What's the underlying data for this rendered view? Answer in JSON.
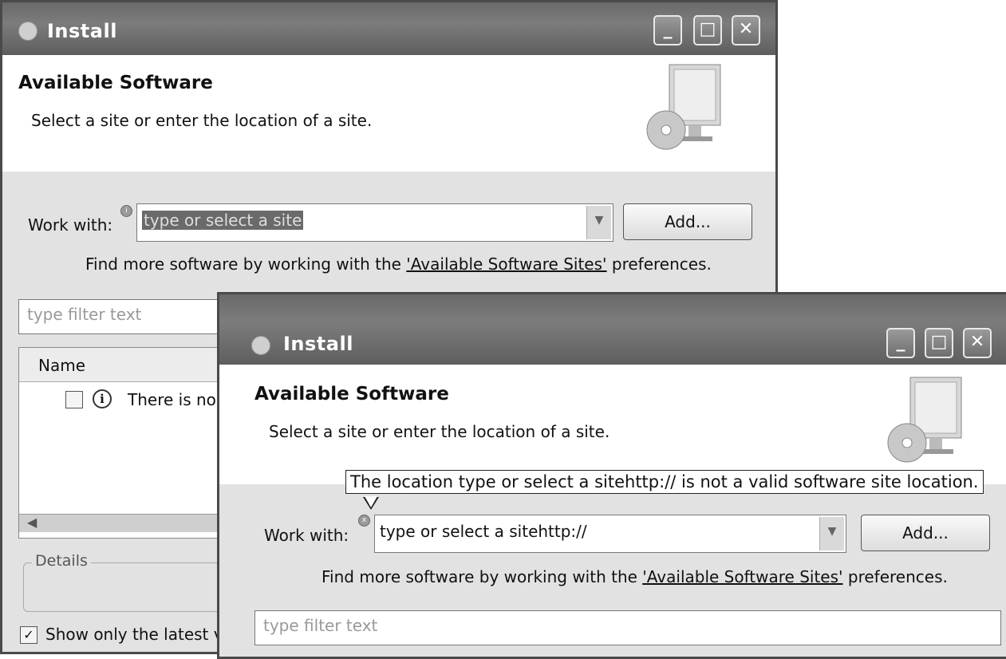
{
  "back_window": {
    "title": "Install",
    "header": {
      "title": "Available Software",
      "subtitle": "Select a site or enter the location of a site."
    },
    "work_with_label": "Work with:",
    "work_with_value": "type or select a site",
    "add_button": "Add...",
    "find_more_prefix": "Find more software by working with the ",
    "find_more_link": "'Available Software Sites'",
    "find_more_suffix": " preferences.",
    "filter_placeholder": "type filter text",
    "table": {
      "column_name": "Name",
      "row_text": "There is no si"
    },
    "details_label": "Details",
    "show_latest_label": "Show only the latest v"
  },
  "front_window": {
    "title": "Install",
    "header": {
      "title": "Available Software",
      "subtitle": "Select a site or enter the location of a site."
    },
    "tooltip": "The location type or select a sitehttp:// is not a valid software site location.",
    "work_with_label": "Work with:",
    "work_with_value": "type or select a sitehttp://",
    "add_button": "Add...",
    "find_more_prefix": "Find more software by working with the ",
    "find_more_link": "'Available Software Sites'",
    "find_more_suffix": " preferences.",
    "filter_placeholder": "type filter text"
  },
  "window_buttons": {
    "minimize": "_",
    "maximize": "□",
    "close": "✕"
  }
}
